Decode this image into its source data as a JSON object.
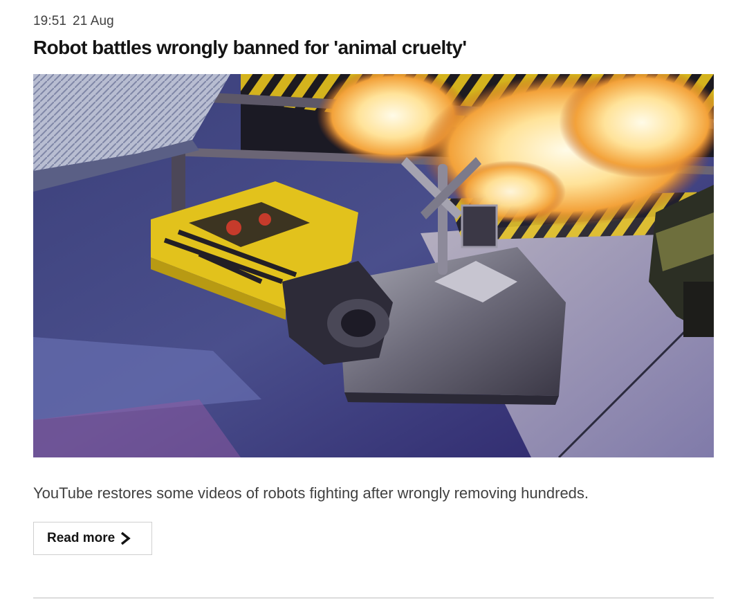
{
  "post": {
    "time": "19:51",
    "date": "21 Aug",
    "headline": "Robot battles wrongly banned for 'animal cruelty'",
    "summary": "YouTube restores some videos of robots fighting after wrongly removing hundreds.",
    "read_more_label": "Read more",
    "read_more_icon": "chevron-right-icon",
    "image_subject": "robots fighting"
  },
  "colors": {
    "headline": "#141414",
    "body_text": "#404040",
    "button_border": "#cfcfcf",
    "divider": "#dcdcdc"
  }
}
